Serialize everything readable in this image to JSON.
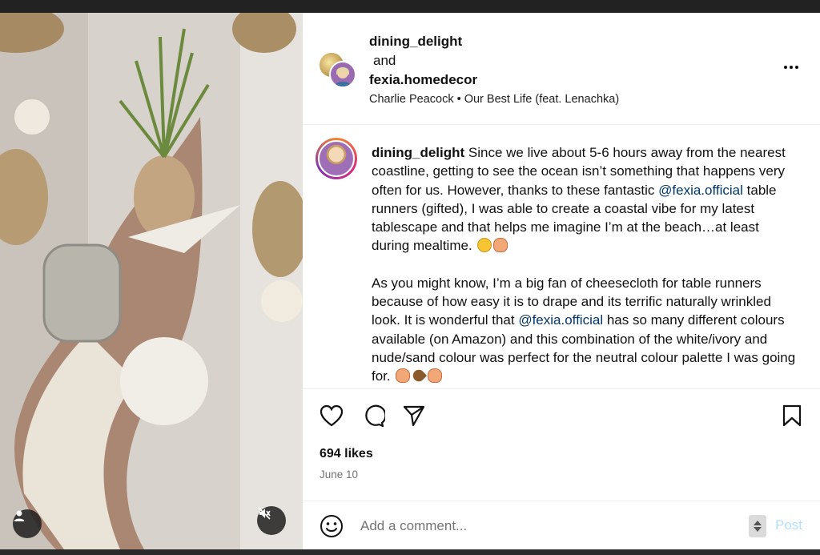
{
  "header": {
    "user1": "dining_delight",
    "and": "and",
    "user2": "fexia.homedecor",
    "audio": "Charlie Peacock • Our Best Life (feat. Lenachka)"
  },
  "caption": {
    "username": "dining_delight",
    "p1_a": " Since we live about 5-6 hours away from the nearest coastline, getting to see the ocean isn’t something that happens very often for us. However, thanks to these fantastic ",
    "mention1": "@fexia.official",
    "p1_b": " table runners (gifted), I was able to create a coastal vibe for my latest tablescape and that helps me imagine I’m at the beach…at least during mealtime.",
    "p2_a": "As you might know, I’m a big fan of cheesecloth for table runners because of how easy it is to drape and its terrific naturally wrinkled look. It is wonderful that ",
    "mention2": "@fexia.official",
    "p2_b": " has so many different colours available (on Amazon) and this combination of the white/ivory and nude/sand colour was perfect for the neutral colour palette I was going for."
  },
  "stats": {
    "likes": "694 likes",
    "date": "June 10"
  },
  "comment_box": {
    "placeholder": "Add a comment...",
    "post_label": "Post"
  },
  "icons": {
    "like": "heart-icon",
    "comment": "comment-icon",
    "share": "send-icon",
    "save": "bookmark-icon",
    "emoji": "smiley-icon",
    "tags": "user-icon",
    "audio": "mute-icon",
    "more": "more-icon"
  },
  "colors": {
    "mention": "#00376b",
    "post_disabled": "#b2dffc",
    "secondary_text": "#737373"
  }
}
